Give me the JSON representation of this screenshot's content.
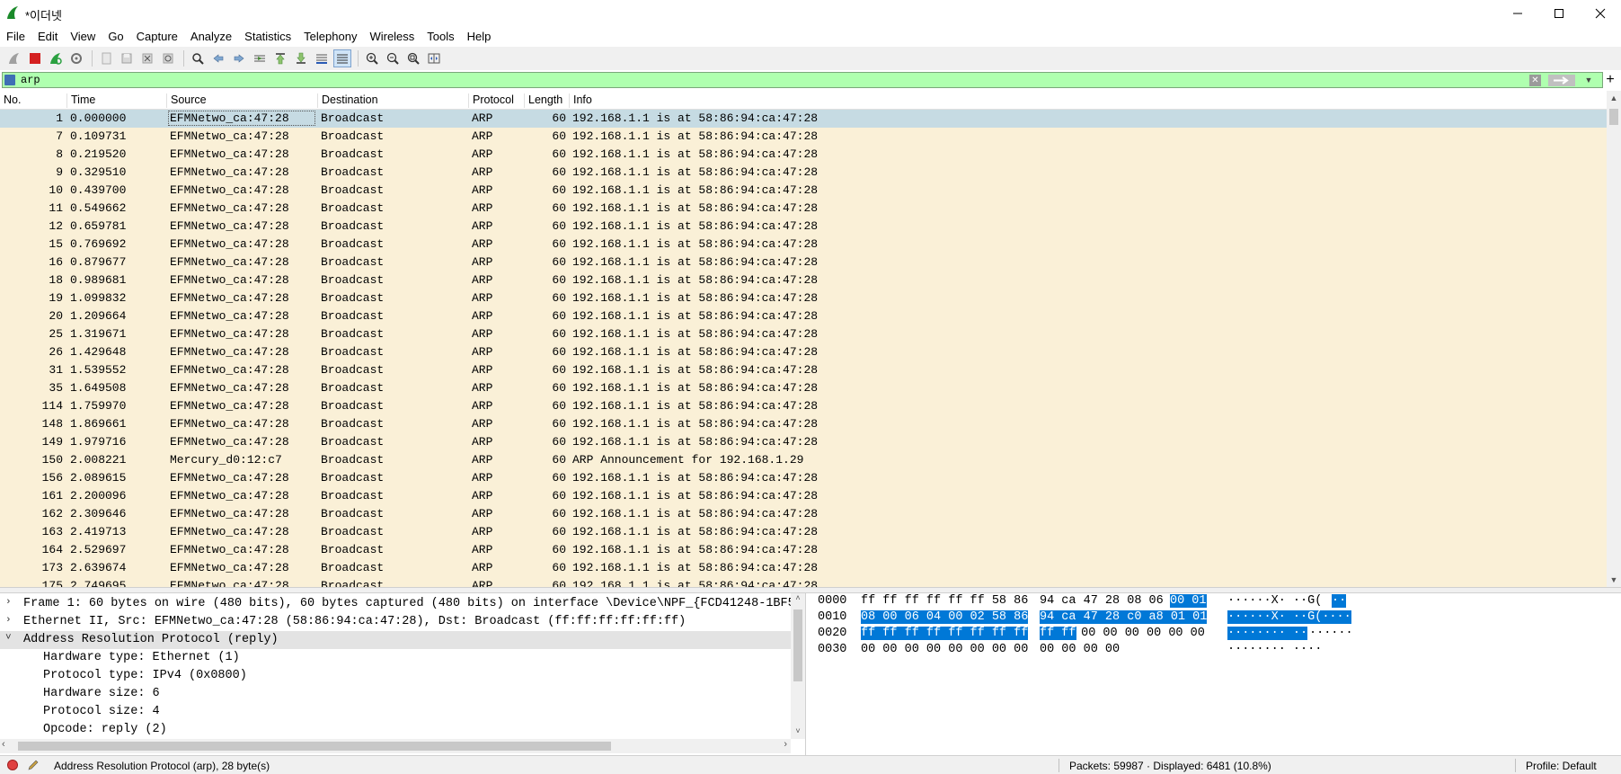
{
  "window": {
    "title": "*이더넷"
  },
  "menu": [
    "File",
    "Edit",
    "View",
    "Go",
    "Capture",
    "Analyze",
    "Statistics",
    "Telephony",
    "Wireless",
    "Tools",
    "Help"
  ],
  "filter": {
    "value": "arp"
  },
  "columns": [
    "No.",
    "Time",
    "Source",
    "Destination",
    "Protocol",
    "Length",
    "Info"
  ],
  "packets": [
    {
      "no": "1",
      "time": "0.000000",
      "src": "EFMNetwo_ca:47:28",
      "dst": "Broadcast",
      "proto": "ARP",
      "len": "60",
      "info": "192.168.1.1 is at 58:86:94:ca:47:28"
    },
    {
      "no": "7",
      "time": "0.109731",
      "src": "EFMNetwo_ca:47:28",
      "dst": "Broadcast",
      "proto": "ARP",
      "len": "60",
      "info": "192.168.1.1 is at 58:86:94:ca:47:28"
    },
    {
      "no": "8",
      "time": "0.219520",
      "src": "EFMNetwo_ca:47:28",
      "dst": "Broadcast",
      "proto": "ARP",
      "len": "60",
      "info": "192.168.1.1 is at 58:86:94:ca:47:28"
    },
    {
      "no": "9",
      "time": "0.329510",
      "src": "EFMNetwo_ca:47:28",
      "dst": "Broadcast",
      "proto": "ARP",
      "len": "60",
      "info": "192.168.1.1 is at 58:86:94:ca:47:28"
    },
    {
      "no": "10",
      "time": "0.439700",
      "src": "EFMNetwo_ca:47:28",
      "dst": "Broadcast",
      "proto": "ARP",
      "len": "60",
      "info": "192.168.1.1 is at 58:86:94:ca:47:28"
    },
    {
      "no": "11",
      "time": "0.549662",
      "src": "EFMNetwo_ca:47:28",
      "dst": "Broadcast",
      "proto": "ARP",
      "len": "60",
      "info": "192.168.1.1 is at 58:86:94:ca:47:28"
    },
    {
      "no": "12",
      "time": "0.659781",
      "src": "EFMNetwo_ca:47:28",
      "dst": "Broadcast",
      "proto": "ARP",
      "len": "60",
      "info": "192.168.1.1 is at 58:86:94:ca:47:28"
    },
    {
      "no": "15",
      "time": "0.769692",
      "src": "EFMNetwo_ca:47:28",
      "dst": "Broadcast",
      "proto": "ARP",
      "len": "60",
      "info": "192.168.1.1 is at 58:86:94:ca:47:28"
    },
    {
      "no": "16",
      "time": "0.879677",
      "src": "EFMNetwo_ca:47:28",
      "dst": "Broadcast",
      "proto": "ARP",
      "len": "60",
      "info": "192.168.1.1 is at 58:86:94:ca:47:28"
    },
    {
      "no": "18",
      "time": "0.989681",
      "src": "EFMNetwo_ca:47:28",
      "dst": "Broadcast",
      "proto": "ARP",
      "len": "60",
      "info": "192.168.1.1 is at 58:86:94:ca:47:28"
    },
    {
      "no": "19",
      "time": "1.099832",
      "src": "EFMNetwo_ca:47:28",
      "dst": "Broadcast",
      "proto": "ARP",
      "len": "60",
      "info": "192.168.1.1 is at 58:86:94:ca:47:28"
    },
    {
      "no": "20",
      "time": "1.209664",
      "src": "EFMNetwo_ca:47:28",
      "dst": "Broadcast",
      "proto": "ARP",
      "len": "60",
      "info": "192.168.1.1 is at 58:86:94:ca:47:28"
    },
    {
      "no": "25",
      "time": "1.319671",
      "src": "EFMNetwo_ca:47:28",
      "dst": "Broadcast",
      "proto": "ARP",
      "len": "60",
      "info": "192.168.1.1 is at 58:86:94:ca:47:28"
    },
    {
      "no": "26",
      "time": "1.429648",
      "src": "EFMNetwo_ca:47:28",
      "dst": "Broadcast",
      "proto": "ARP",
      "len": "60",
      "info": "192.168.1.1 is at 58:86:94:ca:47:28"
    },
    {
      "no": "31",
      "time": "1.539552",
      "src": "EFMNetwo_ca:47:28",
      "dst": "Broadcast",
      "proto": "ARP",
      "len": "60",
      "info": "192.168.1.1 is at 58:86:94:ca:47:28"
    },
    {
      "no": "35",
      "time": "1.649508",
      "src": "EFMNetwo_ca:47:28",
      "dst": "Broadcast",
      "proto": "ARP",
      "len": "60",
      "info": "192.168.1.1 is at 58:86:94:ca:47:28"
    },
    {
      "no": "114",
      "time": "1.759970",
      "src": "EFMNetwo_ca:47:28",
      "dst": "Broadcast",
      "proto": "ARP",
      "len": "60",
      "info": "192.168.1.1 is at 58:86:94:ca:47:28"
    },
    {
      "no": "148",
      "time": "1.869661",
      "src": "EFMNetwo_ca:47:28",
      "dst": "Broadcast",
      "proto": "ARP",
      "len": "60",
      "info": "192.168.1.1 is at 58:86:94:ca:47:28"
    },
    {
      "no": "149",
      "time": "1.979716",
      "src": "EFMNetwo_ca:47:28",
      "dst": "Broadcast",
      "proto": "ARP",
      "len": "60",
      "info": "192.168.1.1 is at 58:86:94:ca:47:28"
    },
    {
      "no": "150",
      "time": "2.008221",
      "src": "Mercury_d0:12:c7",
      "dst": "Broadcast",
      "proto": "ARP",
      "len": "60",
      "info": "ARP Announcement for 192.168.1.29"
    },
    {
      "no": "156",
      "time": "2.089615",
      "src": "EFMNetwo_ca:47:28",
      "dst": "Broadcast",
      "proto": "ARP",
      "len": "60",
      "info": "192.168.1.1 is at 58:86:94:ca:47:28"
    },
    {
      "no": "161",
      "time": "2.200096",
      "src": "EFMNetwo_ca:47:28",
      "dst": "Broadcast",
      "proto": "ARP",
      "len": "60",
      "info": "192.168.1.1 is at 58:86:94:ca:47:28"
    },
    {
      "no": "162",
      "time": "2.309646",
      "src": "EFMNetwo_ca:47:28",
      "dst": "Broadcast",
      "proto": "ARP",
      "len": "60",
      "info": "192.168.1.1 is at 58:86:94:ca:47:28"
    },
    {
      "no": "163",
      "time": "2.419713",
      "src": "EFMNetwo_ca:47:28",
      "dst": "Broadcast",
      "proto": "ARP",
      "len": "60",
      "info": "192.168.1.1 is at 58:86:94:ca:47:28"
    },
    {
      "no": "164",
      "time": "2.529697",
      "src": "EFMNetwo_ca:47:28",
      "dst": "Broadcast",
      "proto": "ARP",
      "len": "60",
      "info": "192.168.1.1 is at 58:86:94:ca:47:28"
    },
    {
      "no": "173",
      "time": "2.639674",
      "src": "EFMNetwo_ca:47:28",
      "dst": "Broadcast",
      "proto": "ARP",
      "len": "60",
      "info": "192.168.1.1 is at 58:86:94:ca:47:28"
    },
    {
      "no": "175",
      "time": "2.749695",
      "src": "EFMNetwo_ca:47:28",
      "dst": "Broadcast",
      "proto": "ARP",
      "len": "60",
      "info": "192.168.1.1 is at 58:86:94:ca:47:28"
    }
  ],
  "selected_packet": 0,
  "details": [
    {
      "arrow": ">",
      "text": "Frame 1: 60 bytes on wire (480 bits), 60 bytes captured (480 bits) on interface \\Device\\NPF_{FCD41248-1BF5-",
      "indent": 0
    },
    {
      "arrow": ">",
      "text": "Ethernet II, Src: EFMNetwo_ca:47:28 (58:86:94:ca:47:28), Dst: Broadcast (ff:ff:ff:ff:ff:ff)",
      "indent": 0
    },
    {
      "arrow": "v",
      "text": "Address Resolution Protocol (reply)",
      "indent": 0,
      "selected": true
    },
    {
      "arrow": "",
      "text": "Hardware type: Ethernet (1)",
      "indent": 1
    },
    {
      "arrow": "",
      "text": "Protocol type: IPv4 (0x0800)",
      "indent": 1
    },
    {
      "arrow": "",
      "text": "Hardware size: 6",
      "indent": 1
    },
    {
      "arrow": "",
      "text": "Protocol size: 4",
      "indent": 1
    },
    {
      "arrow": "",
      "text": "Opcode: reply (2)",
      "indent": 1
    }
  ],
  "bytes": [
    {
      "offset": "0000",
      "hex1": "ff ff ff ff ff ff 58 86",
      "hex2_plain": "94 ca 47 28 08 06",
      "hex2_hl": "00 01",
      "ascii_plain": "······X· ··G(",
      "ascii_hl": "··"
    },
    {
      "offset": "0010",
      "hex1_hl": "08 00 06 04 00 02 58 86",
      "hex2_hl": "94 ca 47 28 c0 a8 01 01",
      "ascii_hl": "······X· ··G(····"
    },
    {
      "offset": "0020",
      "hex1_hl": "ff ff ff ff ff ff ff ff",
      "hex2_hl": "ff ff",
      "hex2_plain": " 00 00 00 00 00 00",
      "ascii_hl": "········ ··",
      "ascii_plain": "······"
    },
    {
      "offset": "0030",
      "hex1": "00 00 00 00 00 00 00 00",
      "hex2_plain": "00 00 00 00",
      "ascii_plain": "········ ····"
    }
  ],
  "status": {
    "left": "Address Resolution Protocol (arp), 28 byte(s)",
    "packets": "Packets: 59987 · Displayed: 6481 (10.8%)",
    "profile": "Profile: Default"
  },
  "colors": {
    "row_bg": "#faf0d7",
    "row_selected": "#c6dbe3",
    "filter_bg": "#afffaf",
    "byte_highlight": "#0078d7"
  }
}
